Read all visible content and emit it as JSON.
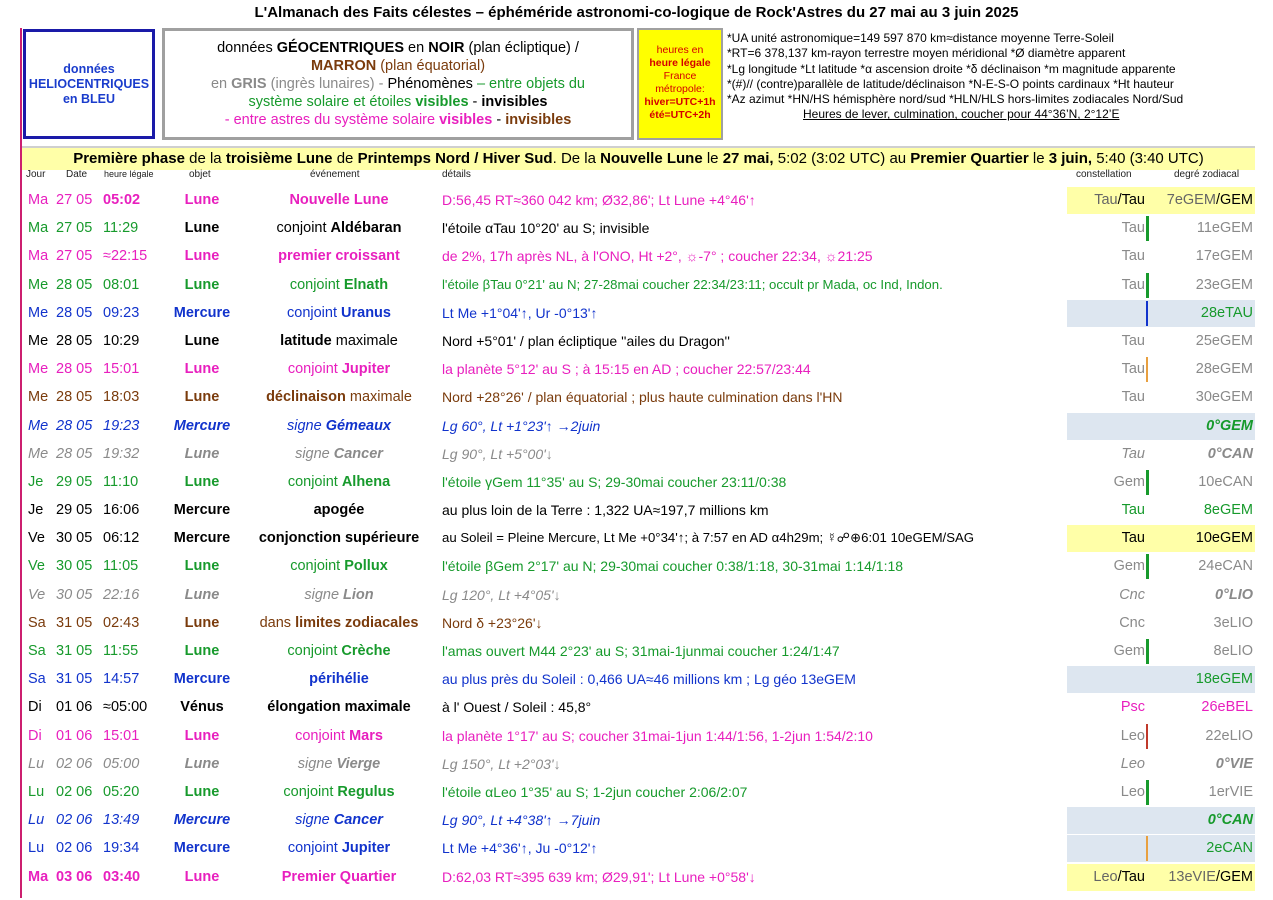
{
  "title": "L'Almanach des Faits célestes – éphéméride astronomi-co-logique de Rock'Astres du 27 mai au 3 juin 2025",
  "helio": {
    "l1": "données",
    "l2": "HELIOCENTRIQUES",
    "l3": "en BLEU"
  },
  "geo": {
    "a1": "données ",
    "a2": "GÉOCENTRIQUES",
    "a3": " en ",
    "a4": "NOIR",
    "a5": " (plan écliptique)  /",
    "b1": "MARRON",
    "b2": " (plan équatorial)",
    "c1": "en ",
    "c2": "GRIS",
    "c3": " (ingrès lunaires)  -  ",
    "c4": "Phénomènes",
    "c5": " – entre objets du",
    "d1": "système solaire et étoiles ",
    "d2": "visibles",
    "d3": " - ",
    "d4": "invisibles",
    "e1": "- entre astres du système solaire ",
    "e2": "visibles",
    "e3": " - ",
    "e4": "invisibles"
  },
  "heures": {
    "l1": "heures en",
    "l2": "heure légale",
    "l3": "France",
    "l4": "métropole:",
    "l5": "hiver=UTC+1h",
    "l6": "été=UTC+2h"
  },
  "legend": [
    "*UA unité astronomique=149 597 870 km≈distance moyenne Terre-Soleil",
    "*RT=6 378,137 km-rayon terrestre moyen méridional   *Ø diamètre apparent",
    "*Lg longitude *Lt latitude  *α ascension droite *δ déclinaison  *m magnitude apparente",
    "*(#)// (contre)parallèle de latitude/déclinaison  *N-E-S-O points cardinaux  *Ht hauteur",
    "*Az azimut  *HN/HS hémisphère nord/sud  *HLN/HLS hors-limites zodiacales Nord/Sud"
  ],
  "legend_last": "Heures de lever, culmination, coucher pour 44°36’N, 2°12’E",
  "phase": {
    "p1": "Première phase",
    "p2": " de la ",
    "p3": "troisième Lune",
    "p4": " de ",
    "p5": "Printemps Nord / Hiver Sud",
    "p6": ". De la ",
    "p7": "Nouvelle Lune",
    "p8": " le ",
    "p9": "27 mai,",
    "p10": " 5:02 (3:02 UTC) au ",
    "p11": "Premier Quartier",
    "p12": " le ",
    "p13": "3 juin,",
    "p14": " 5:40 (3:40 UTC)"
  },
  "headers": {
    "day": "Jour",
    "date": "Date",
    "hour": "heure légale",
    "object": "objet",
    "event": "événement",
    "details": "détails",
    "constellation": "constellation",
    "degree": "degré zodiacal"
  },
  "rows": [
    {
      "day": "Ma",
      "date": "27 05",
      "hour": "05:02",
      "object": "Lune",
      "e1": "Nouvelle Lune",
      "e2": "",
      "details": "D:56,45 RT≈360 042 km; Ø32,86'; Lt Lune +4°46'↑",
      "con_a": "Tau",
      "con_b": "/Tau",
      "deg_a": "7eGEM",
      "deg_b": "/GEM"
    },
    {
      "day": "Ma",
      "date": "27 05",
      "hour": "11:29",
      "object": "Lune",
      "e1": "conjoint ",
      "e2": "Aldébaran",
      "details": "l'étoile αTau 10°20' au S; invisible",
      "con_a": "Tau",
      "con_b": "",
      "deg_a": "11eGEM",
      "deg_b": ""
    },
    {
      "day": "Ma",
      "date": "27 05",
      "hour": "≈22:15",
      "object": "Lune",
      "e1": "premier croissant",
      "e2": "",
      "details": "de 2%, 17h après NL, à l'ONO, Ht +2°, ☼-7° ; coucher 22:34, ☼21:25",
      "con_a": "Tau",
      "con_b": "",
      "deg_a": "17eGEM",
      "deg_b": ""
    },
    {
      "day": "Me",
      "date": "28 05",
      "hour": "08:01",
      "object": "Lune",
      "e1": "conjoint ",
      "e2": "Elnath",
      "details": "l'étoile βTau 0°21' au N; 27-28mai coucher 22:34/23:11; occult pr Mada, oc Ind, Indon.",
      "con_a": "Tau",
      "con_b": "",
      "deg_a": "23eGEM",
      "deg_b": ""
    },
    {
      "day": "Me",
      "date": "28 05",
      "hour": "09:23",
      "object": "Mercure",
      "e1": "conjoint ",
      "e2": "Uranus",
      "details": "Lt Me +1°04'↑, Ur -0°13'↑",
      "con_a": "",
      "con_b": "",
      "deg_a": "28eTAU",
      "deg_b": ""
    },
    {
      "day": "Me",
      "date": "28 05",
      "hour": "10:29",
      "object": "Lune",
      "e1": "latitude",
      "e2": " maximale",
      "details": "Nord +5°01' / plan écliptique ''ailes du Dragon''",
      "con_a": "Tau",
      "con_b": "",
      "deg_a": "25eGEM",
      "deg_b": ""
    },
    {
      "day": "Me",
      "date": "28 05",
      "hour": "15:01",
      "object": "Lune",
      "e1": "conjoint ",
      "e2": "Jupiter",
      "details": "la planète 5°12' au S ; à 15:15 en AD ; coucher 22:57/23:44",
      "con_a": "Tau",
      "con_b": "",
      "deg_a": "28eGEM",
      "deg_b": ""
    },
    {
      "day": "Me",
      "date": "28 05",
      "hour": "18:03",
      "object": "Lune",
      "e1": "déclinaison",
      "e2": " maximale",
      "details": "Nord +28°26' / plan équatorial ; plus haute culmination dans l'HN",
      "con_a": "Tau",
      "con_b": "",
      "deg_a": "30eGEM",
      "deg_b": ""
    },
    {
      "day": "Me",
      "date": "28 05",
      "hour": "19:23",
      "object": "Mercure",
      "e1": "signe ",
      "e2": "Gémeaux",
      "details": "Lg 60°, Lt +1°23'↑ →2juin",
      "con_a": "",
      "con_b": "",
      "deg_a": "0°GEM",
      "deg_b": ""
    },
    {
      "day": "Me",
      "date": "28 05",
      "hour": "19:32",
      "object": "Lune",
      "e1": "signe ",
      "e2": "Cancer",
      "details": "Lg 90°, Lt +5°00'↓",
      "con_a": "Tau",
      "con_b": "",
      "deg_a": "0°CAN",
      "deg_b": ""
    },
    {
      "day": "Je",
      "date": "29 05",
      "hour": "11:10",
      "object": "Lune",
      "e1": "conjoint ",
      "e2": "Alhena",
      "details": "l'étoile γGem 11°35' au S; 29-30mai coucher 23:11/0:38",
      "con_a": "Gem",
      "con_b": "",
      "deg_a": "10eCAN",
      "deg_b": ""
    },
    {
      "day": "Je",
      "date": "29 05",
      "hour": "16:06",
      "object": "Mercure",
      "e1": "apogée",
      "e2": "",
      "details": "au plus loin de la Terre : 1,322 UA≈197,7 millions km",
      "con_a": "Tau",
      "con_b": "",
      "deg_a": "8eGEM",
      "deg_b": ""
    },
    {
      "day": "Ve",
      "date": "30 05",
      "hour": "06:12",
      "object": "Mercure",
      "e1": "conjonction supérieure",
      "e2": "",
      "details": "au Soleil = Pleine Mercure, Lt Me +0°34'↑; à 7:57 en AD α4h29m; ☿☍⊕6:01 10eGEM/SAG",
      "con_a": "Tau",
      "con_b": "",
      "deg_a": "10eGEM",
      "deg_b": ""
    },
    {
      "day": "Ve",
      "date": "30 05",
      "hour": "11:05",
      "object": "Lune",
      "e1": "conjoint ",
      "e2": "Pollux",
      "details": "l'étoile βGem 2°17' au N; 29-30mai coucher 0:38/1:18, 30-31mai 1:14/1:18",
      "con_a": "Gem",
      "con_b": "",
      "deg_a": "24eCAN",
      "deg_b": ""
    },
    {
      "day": "Ve",
      "date": "30 05",
      "hour": "22:16",
      "object": "Lune",
      "e1": "signe ",
      "e2": "Lion",
      "details": "Lg 120°, Lt +4°05'↓",
      "con_a": "Cnc",
      "con_b": "",
      "deg_a": "0°LIO",
      "deg_b": ""
    },
    {
      "day": "Sa",
      "date": "31 05",
      "hour": "02:43",
      "object": "Lune",
      "e1": "dans ",
      "e2": "limites zodiacales",
      "details": "Nord δ +23°26'↓",
      "con_a": "Cnc",
      "con_b": "",
      "deg_a": "3eLIO",
      "deg_b": ""
    },
    {
      "day": "Sa",
      "date": "31 05",
      "hour": "11:55",
      "object": "Lune",
      "e1": "conjoint ",
      "e2": "Crèche",
      "details": "l'amas ouvert M44 2°23' au S; 31mai-1junmai coucher 1:24/1:47",
      "con_a": "Gem",
      "con_b": "",
      "deg_a": "8eLIO",
      "deg_b": ""
    },
    {
      "day": "Sa",
      "date": "31 05",
      "hour": "14:57",
      "object": "Mercure",
      "e1": "périhélie",
      "e2": "",
      "details": "au plus près du Soleil : 0,466 UA≈46 millions km ; Lg géo 13eGEM",
      "con_a": "",
      "con_b": "",
      "deg_a": "18eGEM",
      "deg_b": ""
    },
    {
      "day": "Di",
      "date": "01 06",
      "hour": "≈05:00",
      "object": "Vénus",
      "e1": "élongation maximale",
      "e2": "",
      "details": "à l' Ouest / Soleil : 45,8°",
      "con_a": "Psc",
      "con_b": "",
      "deg_a": "26eBEL",
      "deg_b": ""
    },
    {
      "day": "Di",
      "date": "01 06",
      "hour": "15:01",
      "object": "Lune",
      "e1": "conjoint ",
      "e2": "Mars",
      "details": "la planète 1°17' au S; coucher 31mai-1jun 1:44/1:56, 1-2jun 1:54/2:10",
      "con_a": "Leo",
      "con_b": "",
      "deg_a": "22eLIO",
      "deg_b": ""
    },
    {
      "day": "Lu",
      "date": "02 06",
      "hour": "05:00",
      "object": "Lune",
      "e1": "signe ",
      "e2": "Vierge",
      "details": "Lg 150°, Lt +2°03'↓",
      "con_a": "Leo",
      "con_b": "",
      "deg_a": "0°VIE",
      "deg_b": ""
    },
    {
      "day": "Lu",
      "date": "02 06",
      "hour": "05:20",
      "object": "Lune",
      "e1": "conjoint ",
      "e2": "Regulus",
      "details": "l'étoile αLeo 1°35' au S; 1-2jun coucher 2:06/2:07",
      "con_a": "Leo",
      "con_b": "",
      "deg_a": "1erVIE",
      "deg_b": ""
    },
    {
      "day": "Lu",
      "date": "02 06",
      "hour": "13:49",
      "object": "Mercure",
      "e1": "signe ",
      "e2": "Cancer",
      "details": "Lg 90°, Lt +4°38'↑ →7juin",
      "con_a": "",
      "con_b": "",
      "deg_a": "0°CAN",
      "deg_b": ""
    },
    {
      "day": "Lu",
      "date": "02 06",
      "hour": "19:34",
      "object": "Mercure",
      "e1": "conjoint ",
      "e2": "Jupiter",
      "details": "Lt Me +4°36'↑, Ju -0°12'↑",
      "con_a": "",
      "con_b": "",
      "deg_a": "2eCAN",
      "deg_b": ""
    },
    {
      "day": "Ma",
      "date": "03 06",
      "hour": "03:40",
      "object": "Lune",
      "e1": "Premier Quartier",
      "e2": "",
      "details": "D:62,03 RT≈395 639 km; Ø29,91'; Lt Lune +0°58'↓",
      "con_a": "Leo",
      "con_b": "/Tau",
      "deg_a": "13eVIE",
      "deg_b": "/GEM"
    }
  ],
  "colors": {
    "phase_band": "#ffffa8",
    "constellation_highlight": "#ffffa8",
    "helio_highlight": "#dde6f0",
    "pink": "#e81fbe",
    "green": "#179a2c",
    "blue": "#1133cc",
    "brown": "#7a3b0c",
    "gray": "#8a8a8a"
  }
}
